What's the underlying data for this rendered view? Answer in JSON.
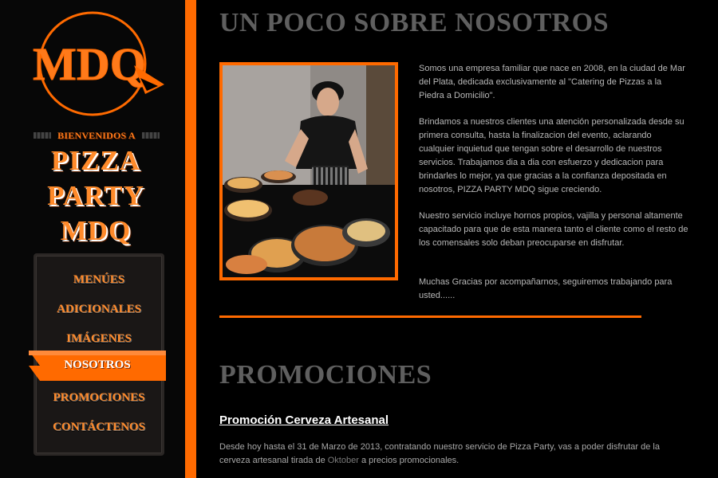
{
  "logo": {
    "text": "MDQ"
  },
  "sidebar": {
    "welcome": "BIENVENIDOS A",
    "brand_lines": [
      "PIZZA",
      "PARTY",
      "MDQ"
    ],
    "menu": [
      {
        "label": "MENÚES",
        "active": false
      },
      {
        "label": "ADICIONALES",
        "active": false
      },
      {
        "label": "IMÁGENES",
        "active": false
      },
      {
        "label": "NOSOTROS",
        "active": true
      },
      {
        "label": "PROMOCIONES",
        "active": false
      },
      {
        "label": "CONTÁCTENOS",
        "active": false
      }
    ]
  },
  "about": {
    "heading": "UN POCO SOBRE NOSOTROS",
    "photo_caption": "Chef with pizzas",
    "paragraphs": [
      "Somos una empresa familiar que nace en 2008, en la ciudad de Mar del Plata, dedicada exclusivamente al \"Catering de Pizzas a la Piedra a Domicilio\".",
      "Brindamos a nuestros clientes una atención personalizada desde su primera consulta, hasta la finalizacion del evento, aclarando cualquier inquietud que tengan sobre el desarrollo de nuestros servicios. Trabajamos dia a dia con esfuerzo y dedicacion para brindarles lo mejor, ya que gracias a la confianza depositada en nosotros, PIZZA PARTY MDQ sigue creciendo.",
      "Nuestro servicio incluye hornos propios, vajilla y personal altamente capacitado para que de esta manera tanto el cliente como el resto de los comensales solo deban preocuparse en disfrutar.",
      "Muchas Gracias por acompañarnos, seguiremos trabajando para usted......"
    ]
  },
  "promos": {
    "heading": "PROMOCIONES",
    "title": "Promoción Cerveza Artesanal",
    "text_before": "Desde hoy hasta el 31 de Marzo de 2013, contratando nuestro servicio de Pizza Party, vas a poder disfrutar de la cerveza artesanal tirada de ",
    "link_text": "Oktober",
    "text_after": " a precios promocionales."
  },
  "colors": {
    "accent": "#ff6a00",
    "heading_gray": "#5f5f5f",
    "text_gray": "#b8b8b8"
  }
}
